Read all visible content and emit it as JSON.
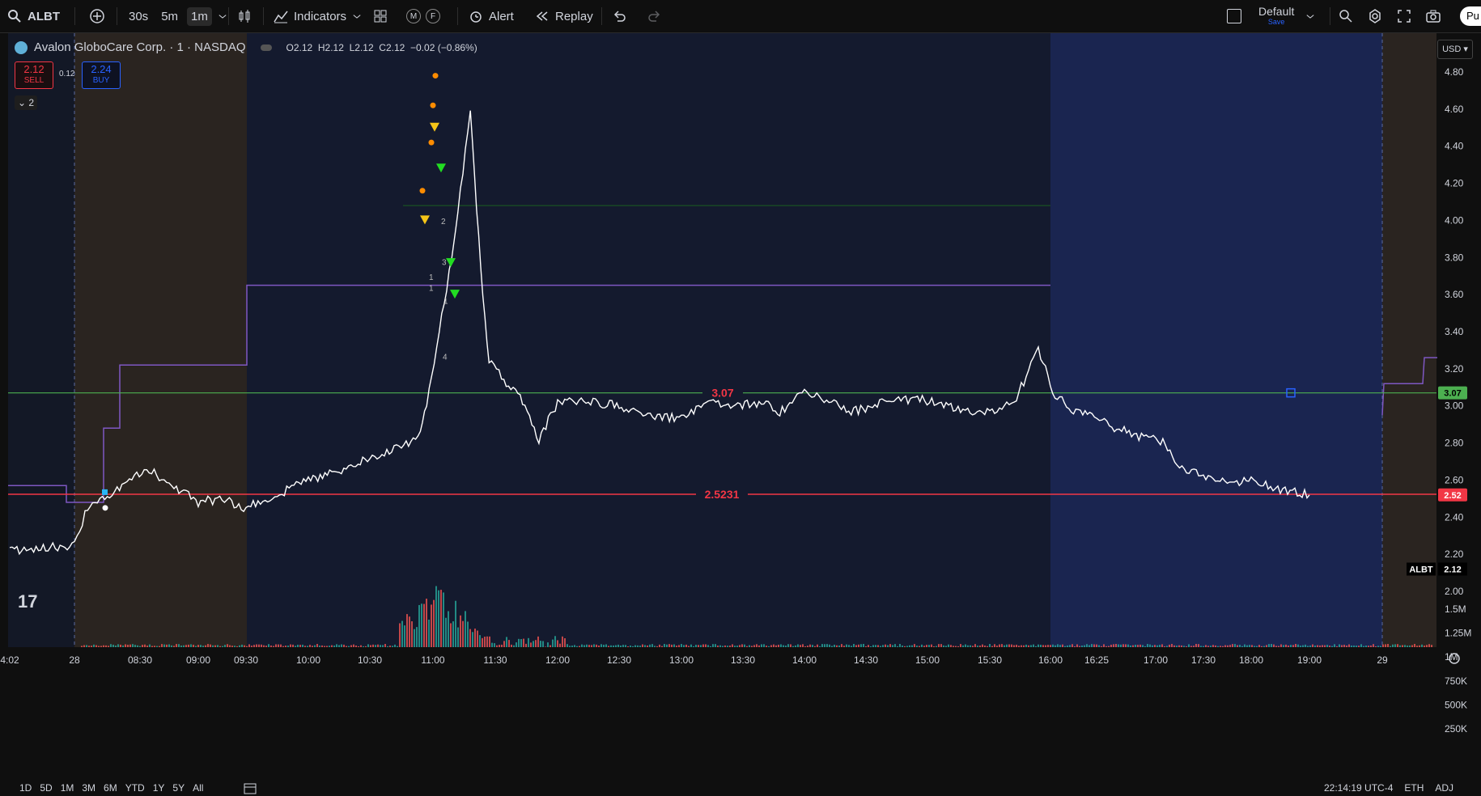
{
  "toolbar": {
    "symbol": "ALBT",
    "intervals": [
      "30s",
      "5m",
      "1m"
    ],
    "active_interval": "1m",
    "indicators_label": "Indicators",
    "m_label": "M",
    "f_label": "F",
    "alert_label": "Alert",
    "replay_label": "Replay",
    "layout_label": "Default",
    "layout_sub": "Save",
    "publish_label": "Pu"
  },
  "legend": {
    "title": "Avalon GloboCare Corp. · 1 · NASDAQ",
    "o_label": "O",
    "o": "2.12",
    "h_label": "H",
    "h": "2.12",
    "l_label": "L",
    "l": "2.12",
    "c_label": "C",
    "c": "2.12",
    "change": "−0.02 (−0.86%)",
    "sell_price": "2.12",
    "sell_label": "SELL",
    "spread": "0.12",
    "buy_price": "2.24",
    "buy_label": "BUY",
    "collapse_count": "2"
  },
  "currency": "USD",
  "bottom": {
    "ranges": [
      "1D",
      "5D",
      "1M",
      "3M",
      "6M",
      "YTD",
      "1Y",
      "5Y",
      "All"
    ],
    "clock": "22:14:19 UTC-4",
    "session": "ETH",
    "adj": "ADJ"
  },
  "colors": {
    "up": "#ffffff",
    "green_line": "#4caf50",
    "red_line": "#f23645",
    "purple_line": "#7e57c2",
    "premarket_bg": "#2a2420",
    "session_bg": "#141a2e",
    "afterhours_bg": "#1a2550"
  },
  "chart_data": {
    "type": "line",
    "ylim": [
      2.0,
      4.8
    ],
    "y_ticks": [
      "4.80",
      "4.60",
      "4.40",
      "4.20",
      "4.00",
      "3.80",
      "3.60",
      "3.40",
      "3.20",
      "3.00",
      "2.80",
      "2.60",
      "2.40",
      "2.20",
      "2.00"
    ],
    "volume_ticks": [
      "1.5M",
      "1.25M",
      "1M",
      "750K",
      "500K",
      "250K"
    ],
    "x_ticks": [
      "4:02",
      "28",
      "08:30",
      "09:00",
      "09:30",
      "10:00",
      "10:30",
      "11:00",
      "11:30",
      "12:00",
      "12:30",
      "13:00",
      "13:30",
      "14:00",
      "14:30",
      "15:00",
      "15:30",
      "16:00",
      "16:25",
      "17:00",
      "17:30",
      "18:00",
      "19:00",
      "29"
    ],
    "price_path": [
      [
        0,
        2.22
      ],
      [
        1.0,
        2.25
      ],
      [
        1.2,
        2.45
      ],
      [
        1.5,
        2.5
      ],
      [
        1.8,
        2.6
      ],
      [
        2.2,
        2.65
      ],
      [
        2.5,
        2.58
      ],
      [
        3.0,
        2.48
      ],
      [
        3.5,
        2.5
      ],
      [
        4.0,
        2.45
      ],
      [
        4.5,
        2.52
      ],
      [
        5.0,
        2.6
      ],
      [
        5.5,
        2.65
      ],
      [
        6.0,
        2.72
      ],
      [
        6.5,
        2.78
      ],
      [
        6.8,
        2.85
      ],
      [
        6.9,
        3.0
      ],
      [
        7.1,
        3.4
      ],
      [
        7.3,
        3.8
      ],
      [
        7.4,
        4.05
      ],
      [
        7.6,
        4.6
      ],
      [
        7.7,
        4.05
      ],
      [
        7.8,
        3.6
      ],
      [
        7.9,
        3.25
      ],
      [
        8.1,
        3.15
      ],
      [
        8.4,
        3.05
      ],
      [
        8.7,
        2.82
      ],
      [
        9.0,
        3.02
      ],
      [
        9.5,
        3.02
      ],
      [
        10.0,
        3.0
      ],
      [
        10.5,
        2.95
      ],
      [
        11.0,
        2.93
      ],
      [
        11.4,
        3.02
      ],
      [
        11.8,
        3.0
      ],
      [
        12.3,
        3.02
      ],
      [
        12.6,
        2.97
      ],
      [
        13.0,
        3.07
      ],
      [
        13.4,
        3.02
      ],
      [
        13.8,
        2.97
      ],
      [
        14.3,
        3.02
      ],
      [
        14.8,
        3.04
      ],
      [
        15.3,
        3.0
      ],
      [
        15.8,
        2.97
      ],
      [
        16.0,
        2.96
      ],
      [
        16.4,
        3.02
      ],
      [
        16.8,
        3.3
      ],
      [
        17.1,
        3.05
      ],
      [
        17.5,
        2.98
      ],
      [
        17.9,
        2.96
      ],
      [
        18.3,
        2.88
      ],
      [
        18.8,
        2.83
      ],
      [
        19.2,
        2.8
      ],
      [
        19.5,
        2.68
      ],
      [
        20.0,
        2.62
      ],
      [
        20.5,
        2.58
      ],
      [
        21.0,
        2.6
      ],
      [
        21.5,
        2.55
      ],
      [
        22.0,
        2.52
      ]
    ],
    "levels": [
      {
        "label": "3.07",
        "value": 3.07
      },
      {
        "label": "2.5231",
        "value": 2.5231
      }
    ],
    "price_tags": [
      {
        "label": "3.07",
        "value": 3.07
      },
      {
        "label": "2.52",
        "value": 2.52
      },
      {
        "label": "ALBT",
        "value": "2.12"
      }
    ],
    "annotations": [
      "1",
      "1",
      "3",
      "2",
      "1",
      "4"
    ]
  }
}
